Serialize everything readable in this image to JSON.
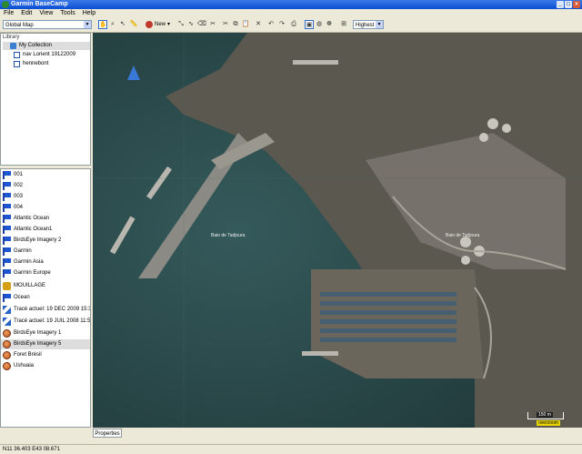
{
  "window": {
    "title": "Garmin BaseCamp"
  },
  "menu": [
    "File",
    "Edit",
    "View",
    "Tools",
    "Help"
  ],
  "toolbar": {
    "map_select": "Global Map",
    "new_label": "New",
    "detail_select": "Highest"
  },
  "library": {
    "title": "Library",
    "items": [
      {
        "label": "My Collection",
        "icon": "folder-icon",
        "selected": true
      },
      {
        "label": "nav Lorient 19122009",
        "icon": "document-icon"
      },
      {
        "label": "hennebont",
        "icon": "document-icon"
      }
    ]
  },
  "items": [
    {
      "label": "001",
      "icon": "flag-icon"
    },
    {
      "label": "002",
      "icon": "flag-icon"
    },
    {
      "label": "003",
      "icon": "flag-icon"
    },
    {
      "label": "004",
      "icon": "flag-icon"
    },
    {
      "label": "Atlantic Ocean",
      "icon": "flag-icon"
    },
    {
      "label": "Atlantic Ocean1",
      "icon": "flag-icon"
    },
    {
      "label": "BirdsEye Imagery 2",
      "icon": "flag-icon"
    },
    {
      "label": "Garmin",
      "icon": "flag-icon"
    },
    {
      "label": "Garmin Asia",
      "icon": "flag-icon"
    },
    {
      "label": "Garmin Europe",
      "icon": "flag-icon"
    },
    {
      "label": "MOUILLAGE",
      "icon": "anchor-icon"
    },
    {
      "label": "Ocean",
      "icon": "flag-icon"
    },
    {
      "label": "Tracé actuel: 19 DEC 2009 15:35",
      "icon": "track-icon"
    },
    {
      "label": "Tracé actuel: 19 JUIL 2008 11:53",
      "icon": "track-icon"
    },
    {
      "label": "BirdsEye Imagery 1",
      "icon": "earth-icon"
    },
    {
      "label": "BirdsEye Imagery 5",
      "icon": "earth-icon",
      "selected": true
    },
    {
      "label": "Foret Brésil",
      "icon": "earth-icon"
    },
    {
      "label": "Ushuaia",
      "icon": "earth-icon"
    }
  ],
  "map": {
    "labels": [
      "Baie de Tadjoura",
      "Baie de Tadjoura"
    ],
    "scale_label": "150 m",
    "overzoom_label": "overzoom"
  },
  "properties_tab": "Properties",
  "status": {
    "coordinates": "N11 36.403 E43 08.671"
  }
}
